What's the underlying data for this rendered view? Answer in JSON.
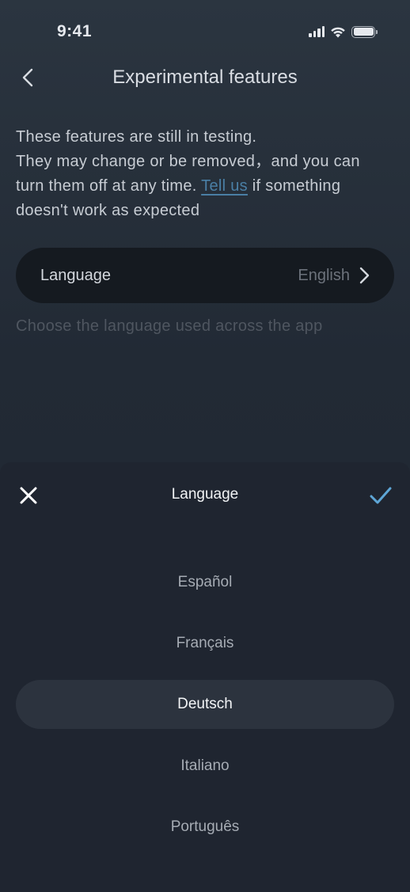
{
  "status_bar": {
    "time": "9:41",
    "icons": [
      "signal-icon",
      "wifi-icon",
      "battery-icon"
    ]
  },
  "header": {
    "back_icon": "chevron-left-icon",
    "title": "Experimental features"
  },
  "description": {
    "line1": "These features are still in testing.",
    "line2": "They may change or be removed，and you can",
    "line3_before_link": "turn them off at any time. ",
    "link_text": "Tell us",
    "line3_after_link": " if something",
    "line4": "doesn't work as expected"
  },
  "setting": {
    "label": "Language",
    "value": "English",
    "chevron_icon": "chevron-right-icon"
  },
  "hint": "Choose the language used across the app",
  "sheet": {
    "close_icon": "close-icon",
    "title": "Language",
    "confirm_icon": "checkmark-icon",
    "options": [
      "Español",
      "Français",
      "Deutsch",
      "Italiano",
      "Português"
    ],
    "selected": "Deutsch"
  },
  "colors": {
    "background": "#222a35",
    "sheet": "#1f2530",
    "link": "#4a7fa5",
    "confirm_accent": "#5ea6d6",
    "selected_row": "#2c333e"
  }
}
